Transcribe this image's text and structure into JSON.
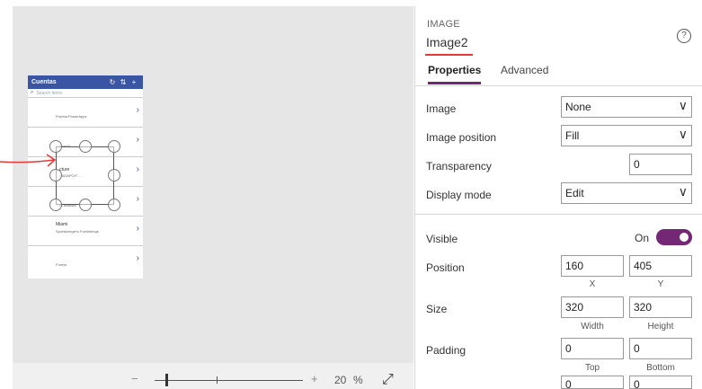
{
  "canvas": {
    "phone": {
      "title": "Cuentas",
      "header_icons": [
        "refresh-icon",
        "sort-icon",
        "add-icon"
      ],
      "search_placeholder": "Search items",
      "rows": [
        {
          "line1": "",
          "line2": "Prueba PowerApps"
        },
        {
          "line1": "",
          "line2": "...ueva N"
        },
        {
          "line1": "...cture",
          "line2": "...T ADAPOIT ..."
        },
        {
          "line1": "",
          "line2": "...sa analistic"
        },
        {
          "line1": "Miami",
          "line2": "Sportsberger's Furnishings"
        },
        {
          "line1": "",
          "line2": "Foreys"
        }
      ]
    },
    "zoom": {
      "value": "20",
      "unit": "%",
      "level": 0.2
    }
  },
  "pane": {
    "control_type": "IMAGE",
    "control_name": "Image2",
    "help_icon": "?",
    "tabs": [
      {
        "label": "Properties",
        "active": true
      },
      {
        "label": "Advanced",
        "active": false
      }
    ],
    "image": {
      "label": "Image",
      "value": "None"
    },
    "image_position": {
      "label": "Image position",
      "value": "Fill"
    },
    "transparency": {
      "label": "Transparency",
      "value": "0"
    },
    "display_mode": {
      "label": "Display mode",
      "value": "Edit"
    },
    "visible": {
      "label": "Visible",
      "state": "On"
    },
    "position": {
      "label": "Position",
      "x": "160",
      "y": "405",
      "x_label": "X",
      "y_label": "Y"
    },
    "size": {
      "label": "Size",
      "width": "320",
      "height": "320",
      "width_label": "Width",
      "height_label": "Height"
    },
    "padding": {
      "label": "Padding",
      "top": "0",
      "bottom": "0",
      "top_label": "Top",
      "bottom_label": "Bottom",
      "left": "0",
      "right": "0"
    }
  },
  "colors": {
    "accent": "#742774",
    "header": "#3955a3",
    "annotation": "#e53935"
  }
}
